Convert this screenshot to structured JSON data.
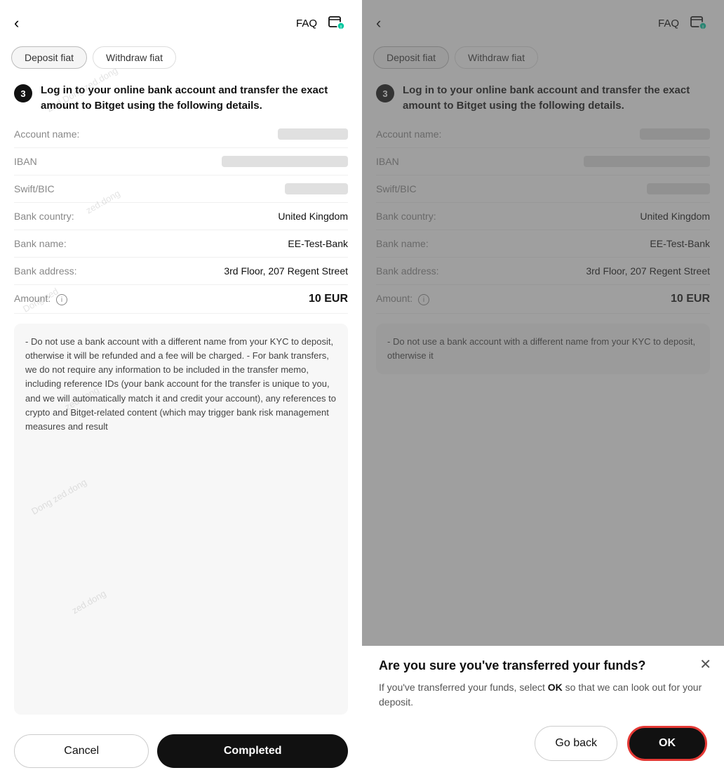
{
  "left": {
    "back_icon": "‹",
    "faq": "FAQ",
    "tabs": [
      {
        "label": "Deposit fiat",
        "active": true
      },
      {
        "label": "Withdraw fiat",
        "active": false
      }
    ],
    "step_number": "3",
    "step_text": "Log in to your online bank account and transfer the exact amount to Bitget using the following details.",
    "details": [
      {
        "label": "Account name:",
        "value": "blurred",
        "value_type": "blurred_short"
      },
      {
        "label": "IBAN",
        "value": "blurred",
        "value_type": "blurred_long"
      },
      {
        "label": "Swift/BIC",
        "value": "blurred",
        "value_type": "blurred_medium"
      },
      {
        "label": "Bank country:",
        "value": "United Kingdom",
        "value_type": "text"
      },
      {
        "label": "Bank name:",
        "value": "EE-Test-Bank",
        "value_type": "text"
      },
      {
        "label": "Bank address:",
        "value": "3rd Floor, 207 Regent Street",
        "value_type": "text"
      },
      {
        "label": "Amount:",
        "value": "10 EUR",
        "value_type": "bold",
        "has_info": true
      }
    ],
    "notice": "- Do not use a bank account with a different name from your KYC to deposit, otherwise it will be refunded and a fee will be charged.\n\n- For bank transfers, we do not require any information to be included in the transfer memo, including reference IDs (your bank account for the transfer is unique to you, and we will automatically match it and credit your account), any references to crypto and Bitget-related content (which may trigger bank risk management measures and result",
    "cancel_btn": "Cancel",
    "completed_btn": "Completed"
  },
  "right": {
    "back_icon": "‹",
    "faq": "FAQ",
    "tabs": [
      {
        "label": "Deposit fiat",
        "active": true
      },
      {
        "label": "Withdraw fiat",
        "active": false
      }
    ],
    "step_number": "3",
    "step_text": "Log in to your online bank account and transfer the exact amount to Bitget using the following details.",
    "details": [
      {
        "label": "Account name:",
        "value": "blurred",
        "value_type": "blurred_short"
      },
      {
        "label": "IBAN",
        "value": "blurred",
        "value_type": "blurred_long"
      },
      {
        "label": "Swift/BIC",
        "value": "blurred",
        "value_type": "blurred_medium"
      },
      {
        "label": "Bank country:",
        "value": "United Kingdom",
        "value_type": "text"
      },
      {
        "label": "Bank name:",
        "value": "EE-Test-Bank",
        "value_type": "text"
      },
      {
        "label": "Bank address:",
        "value": "3rd Floor, 207 Regent Street",
        "value_type": "text"
      },
      {
        "label": "Amount:",
        "value": "10 EUR",
        "value_type": "bold",
        "has_info": true
      }
    ],
    "notice_partial": "- Do not use a bank account with a different name from your KYC to deposit, otherwise it",
    "modal": {
      "close_icon": "✕",
      "title": "Are you sure you've transferred your funds?",
      "body_start": "If you've transferred your funds, select ",
      "body_bold": "OK",
      "body_end": " so that we can look out for your deposit.",
      "go_back_btn": "Go back",
      "ok_btn": "OK"
    }
  }
}
